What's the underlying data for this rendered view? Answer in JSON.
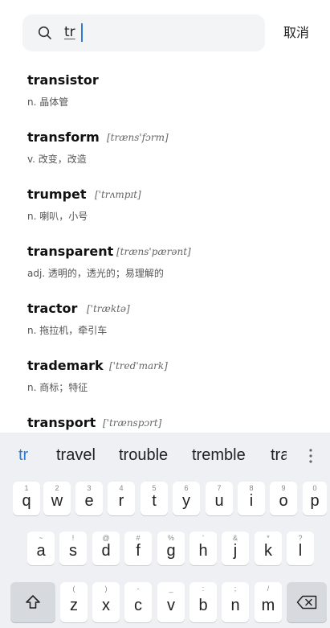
{
  "search": {
    "query": "tr",
    "cancel_label": "取消"
  },
  "results": [
    {
      "word": "transistor",
      "phonetic": "",
      "meaning": "n. 晶体管"
    },
    {
      "word": "transform",
      "phonetic": "[træns'fɔrm]",
      "meaning": "v. 改变，改造"
    },
    {
      "word": "trumpet",
      "phonetic": "['trʌmpɪt]",
      "meaning": "n. 喇叭，小号"
    },
    {
      "word": "transparent",
      "phonetic": "[træns'pærənt]",
      "meaning": "adj. 透明的，透光的；易理解的"
    },
    {
      "word": "tractor",
      "phonetic": "['træktə]",
      "meaning": "n. 拖拉机，牵引车"
    },
    {
      "word": "trademark",
      "phonetic": "['tred'mark]",
      "meaning": "n. 商标；特征"
    },
    {
      "word": "transport",
      "phonetic": "['trænspɔrt]",
      "meaning": ""
    }
  ],
  "keyboard": {
    "suggestions": [
      "tr",
      "travel",
      "trouble",
      "tremble",
      "tra"
    ],
    "row1": [
      {
        "hint": "1",
        "char": "q"
      },
      {
        "hint": "2",
        "char": "w"
      },
      {
        "hint": "3",
        "char": "e"
      },
      {
        "hint": "4",
        "char": "r"
      },
      {
        "hint": "5",
        "char": "t"
      },
      {
        "hint": "6",
        "char": "y"
      },
      {
        "hint": "7",
        "char": "u"
      },
      {
        "hint": "8",
        "char": "i"
      },
      {
        "hint": "9",
        "char": "o"
      },
      {
        "hint": "0",
        "char": "p"
      }
    ],
    "row2": [
      {
        "hint": "~",
        "char": "a"
      },
      {
        "hint": "!",
        "char": "s"
      },
      {
        "hint": "@",
        "char": "d"
      },
      {
        "hint": "#",
        "char": "f"
      },
      {
        "hint": "%",
        "char": "g"
      },
      {
        "hint": "'",
        "char": "h"
      },
      {
        "hint": "&",
        "char": "j"
      },
      {
        "hint": "*",
        "char": "k"
      },
      {
        "hint": "?",
        "char": "l"
      }
    ],
    "row3": [
      {
        "hint": "(",
        "char": "z"
      },
      {
        "hint": ")",
        "char": "x"
      },
      {
        "hint": "-",
        "char": "c"
      },
      {
        "hint": "_",
        "char": "v"
      },
      {
        "hint": ":",
        "char": "b"
      },
      {
        "hint": ";",
        "char": "n"
      },
      {
        "hint": "/",
        "char": "m"
      }
    ],
    "shift_icon": "shift-icon",
    "backspace_icon": "backspace-icon",
    "accent_color": "#2b7cd8"
  }
}
